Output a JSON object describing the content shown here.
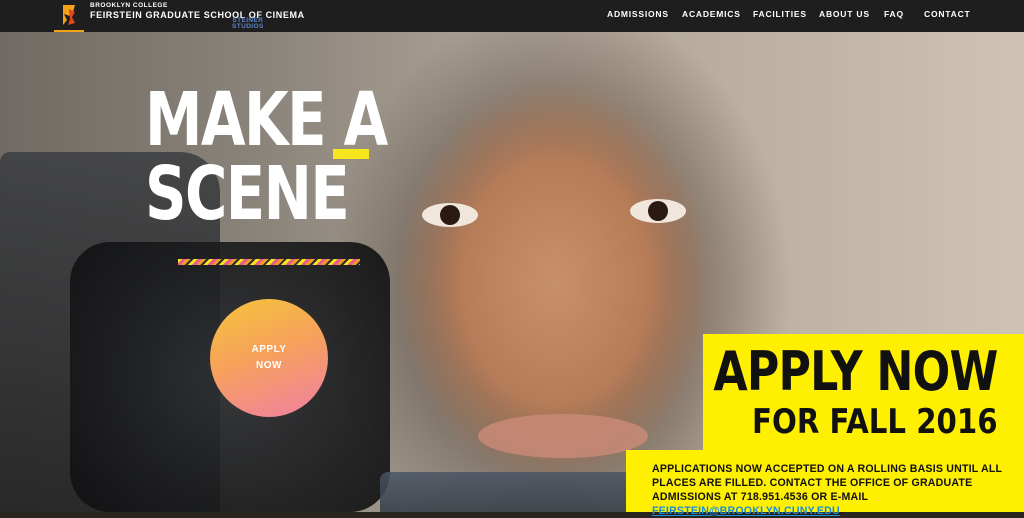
{
  "header": {
    "logo_line1": "BROOKLYN COLLEGE",
    "logo_line2": "FEIRSTEIN GRADUATE SCHOOL OF CINEMA",
    "steiner_line1": "STEINER",
    "steiner_line2": "STUDIOS"
  },
  "nav": {
    "items": [
      "ADMISSIONS",
      "ACADEMICS",
      "FACILITIES",
      "ABOUT US",
      "FAQ",
      "CONTACT"
    ]
  },
  "hero": {
    "headline_line1_part1": "MAKE ",
    "headline_line1_part2": "A",
    "headline_line2": "SCENE",
    "apply_button": "APPLY NOW"
  },
  "callout": {
    "title": "APPLY NOW",
    "subtitle": "FOR FALL 2016",
    "body_prefix": "APPLICATIONS NOW ACCEPTED ON A ROLLING BASIS UNTIL ALL PLACES ARE FILLED. CONTACT THE OFFICE OF GRADUATE ADMISSIONS AT 718.951.4536 OR E-MAIL ",
    "email": "FEIRSTEIN@BROOKLYN.CUNY.EDU",
    "body_suffix": "."
  },
  "colors": {
    "accent_yellow": "#ffef00",
    "email_blue": "#1a8fd6",
    "logo_orange": "#f5a21b"
  }
}
